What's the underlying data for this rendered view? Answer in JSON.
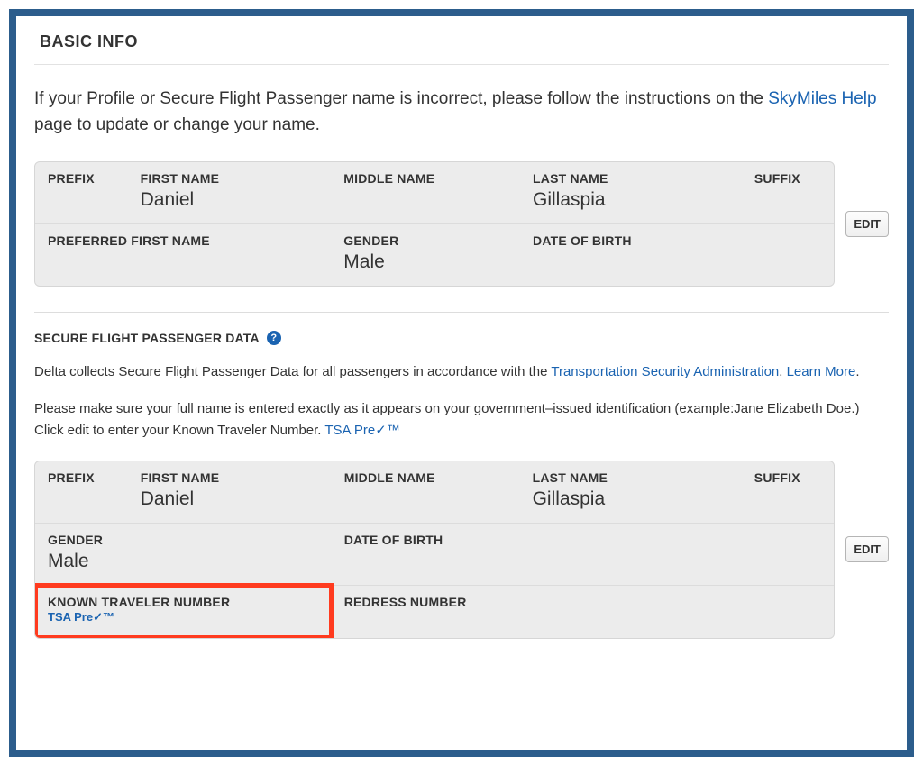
{
  "header": {
    "title": "BASIC INFO"
  },
  "intro": {
    "before": "If your Profile or Secure Flight Passenger name is incorrect, please follow the instructions on the ",
    "link_text": "SkyMiles Help",
    "after": " page to update or change your name."
  },
  "labels": {
    "prefix": "PREFIX",
    "first_name": "FIRST NAME",
    "middle_name": "MIDDLE NAME",
    "last_name": "LAST NAME",
    "suffix": "SUFFIX",
    "preferred_first": "PREFERRED FIRST NAME",
    "gender": "GENDER",
    "dob": "DATE OF BIRTH",
    "ktn": "KNOWN TRAVELER NUMBER",
    "redress": "REDRESS NUMBER",
    "edit": "EDIT"
  },
  "basic": {
    "prefix": "",
    "first_name": "Daniel",
    "middle_name": "",
    "last_name": "Gillaspia",
    "suffix": "",
    "preferred_first": "",
    "gender": "Male",
    "dob": ""
  },
  "sfpd": {
    "heading": "SECURE FLIGHT PASSENGER DATA",
    "help_glyph": "?",
    "line1_before": "Delta collects Secure Flight Passenger Data for all passengers in accordance with the ",
    "tsa_link": "Transportation Security Administration",
    "line1_mid": ". ",
    "learn_more": "Learn More",
    "line1_after": ".",
    "line2_before": "Please make sure your full name is entered exactly as it appears on your government–issued identification (example:Jane Elizabeth Doe.) Click edit to enter your Known Traveler Number. ",
    "tsa_pre": "TSA Pre✓™",
    "fields": {
      "prefix": "",
      "first_name": "Daniel",
      "middle_name": "",
      "last_name": "Gillaspia",
      "suffix": "",
      "gender": "Male",
      "dob": "",
      "ktn_link": "TSA Pre✓™",
      "redress": ""
    }
  }
}
